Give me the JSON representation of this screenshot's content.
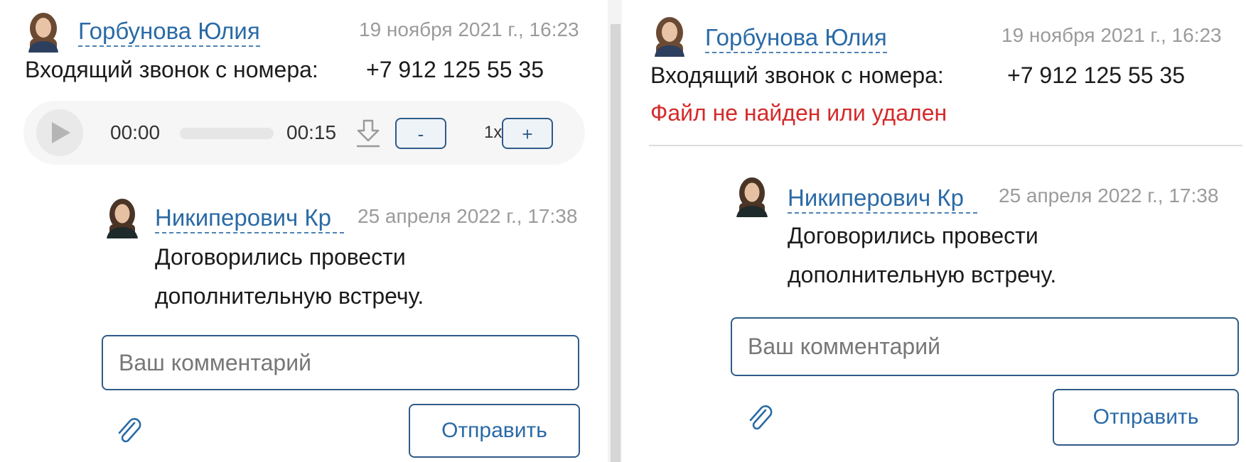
{
  "left": {
    "author": "Горбунова Юлия",
    "date": "19 ноября 2021 г., 16:23",
    "call_label": "Входящий звонок с номера:",
    "phone": "+7 912 125 55 35",
    "player": {
      "current_time": "00:00",
      "total_time": "00:15",
      "progress": 0,
      "minus_label": "-",
      "rate": "1x",
      "plus_label": "+",
      "play_icon": "play-icon",
      "download_icon": "download-icon"
    },
    "comment": {
      "author": "Никиперович Кр",
      "date": "25 апреля 2022 г., 17:38",
      "lines": [
        "Договорились провести",
        "дополнительную встречу."
      ]
    },
    "comment_input": {
      "placeholder": "Ваш комментарий"
    },
    "attach_icon": "paperclip-icon",
    "send_label": "Отправить"
  },
  "right": {
    "author": "Горбунова Юлия",
    "date": "19 ноября 2021 г., 16:23",
    "call_label": "Входящий звонок с номера:",
    "phone": "+7 912 125 55 35",
    "error_text": "Файл не найден или удален",
    "comment": {
      "author": "Никиперович Кр",
      "date": "25 апреля 2022 г., 17:38",
      "lines": [
        "Договорились провести",
        "дополнительную встречу."
      ]
    },
    "comment_input": {
      "placeholder": "Ваш комментарий"
    },
    "attach_icon": "paperclip-icon",
    "send_label": "Отправить"
  },
  "colors": {
    "link": "#2a6aa6",
    "border": "#2f5b88",
    "error": "#d42a2a",
    "muted": "#9b9b9b"
  }
}
